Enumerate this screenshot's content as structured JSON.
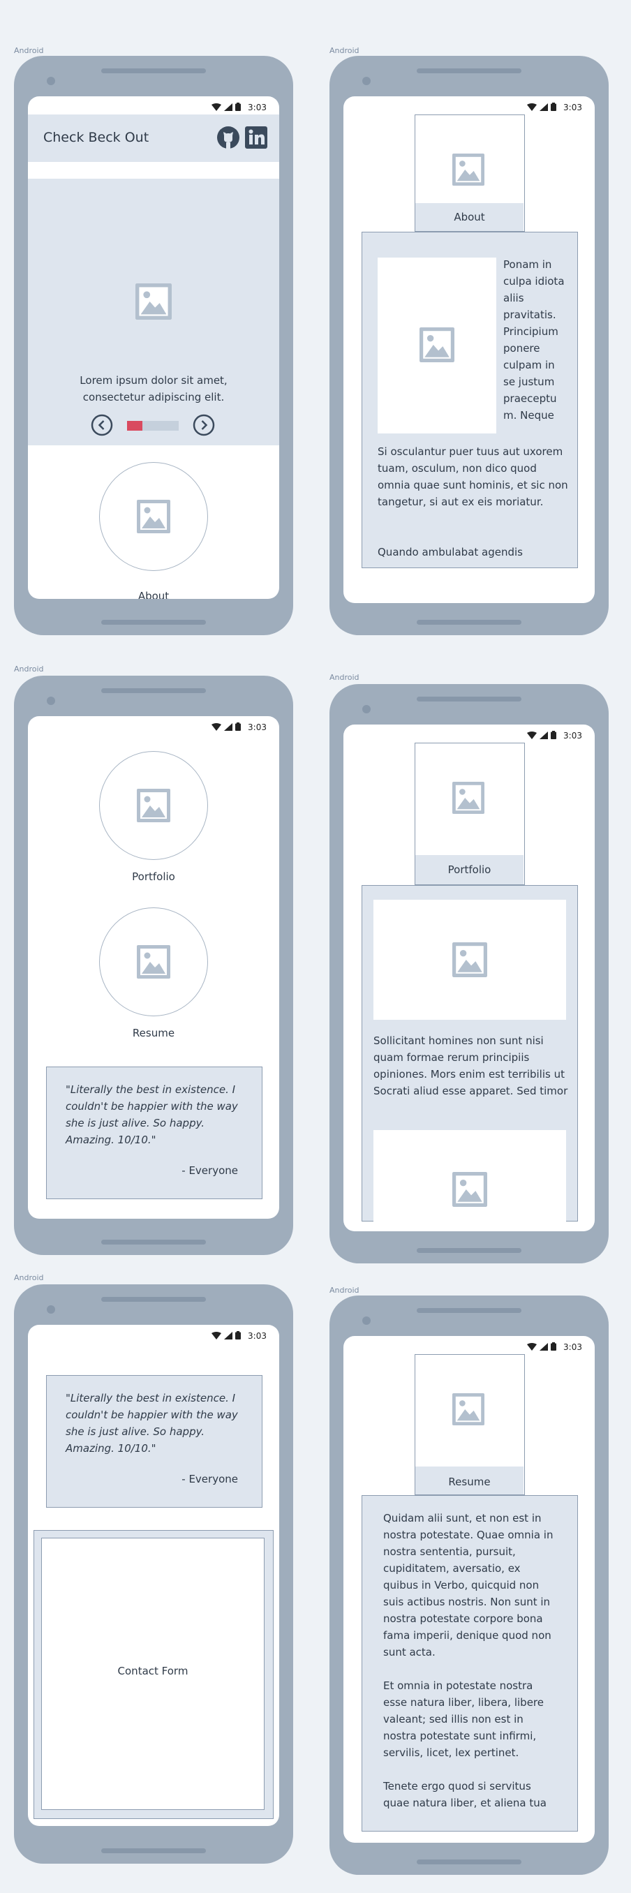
{
  "device_label": "Android",
  "status_time": "3:03",
  "phone1": {
    "app_title": "Check Beck Out",
    "hero_text": "Lorem ipsum dolor sit amet, consectetur adipiscing elit.",
    "carousel_progress": 0.3,
    "about_label": "About"
  },
  "phone2": {
    "tab_label": "About",
    "side_text": "Ponam in culpa idiota aliis pravitatis. Principium ponere culpam in se justum praeceptu m. Neque",
    "body_text": "Si osculantur puer tuus aut uxorem tuam, osculum, non dico quod omnia quae sunt hominis, et sic non tangetur, si aut ex eis moriatur.",
    "body_text2": "Quando ambulabat agendis"
  },
  "phone3": {
    "portfolio_label": "Portfolio",
    "resume_label": "Resume",
    "quote": "\"Literally the best in existence. I couldn't be happier with the way she is just alive. So happy. Amazing. 10/10.\"",
    "quote_author": "- Everyone"
  },
  "phone4": {
    "tab_label": "Portfolio",
    "body_text": "Sollicitant homines non sunt nisi quam formae rerum principiis opiniones. Mors enim est terribilis ut Socrati aliud esse apparet. Sed timor"
  },
  "phone5": {
    "quote": "\"Literally the best in existence. I couldn't be happier with the way she is just alive. So happy. Amazing. 10/10.\"",
    "quote_author": "- Everyone",
    "contact_label": "Contact Form"
  },
  "phone6": {
    "tab_label": "Resume",
    "para1": "Quidam alii sunt, et non est in nostra potestate. Quae omnia in nostra sententia, pursuit, cupiditatem, aversatio, ex quibus in Verbo, quicquid non suis actibus nostris. Non sunt in nostra potestate corpore bona fama imperii, denique quod non sunt acta.",
    "para2": "Et omnia in potestate nostra esse natura liber, libera, libere valeant; sed illis non est in nostra potestate sunt infirmi, servilis, licet, lex pertinet.",
    "para3": "Tenete ergo quod si servitus quae natura liber, et aliena tua"
  },
  "colors": {
    "phone_body": "#9fadbc",
    "panel": "#dee5ee",
    "accent": "#d94a5f",
    "placeholder_icon": "#b3c0ce"
  }
}
